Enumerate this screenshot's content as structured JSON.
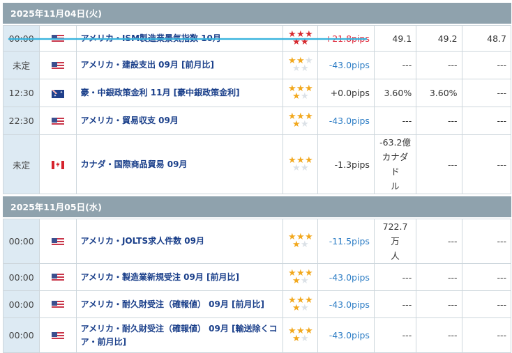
{
  "days": [
    {
      "date": "2025年11月04日(火)",
      "events": [
        {
          "time": "00:00",
          "country": "us",
          "name": "アメリカ・ISM製造業景気指数 10月",
          "stars": [
            "red",
            "red",
            "red",
            "red",
            "red"
          ],
          "pips": "+21.8pips",
          "pips_style": "pos-red",
          "result": "49.1",
          "forecast": "49.2",
          "previous": "48.7",
          "struck": true
        },
        {
          "time": "未定",
          "country": "us",
          "name": "アメリカ・建設支出 09月 [前月比]",
          "stars": [
            "gold",
            "gold",
            "gray",
            "gray",
            "gray"
          ],
          "pips": "-43.0pips",
          "pips_style": "neg",
          "result": "---",
          "forecast": "---",
          "previous": "---"
        },
        {
          "time": "12:30",
          "country": "au",
          "name": "豪・中銀政策金利 11月 [豪中銀政策金利]",
          "stars": [
            "gold",
            "gold",
            "gold",
            "gold",
            "gray"
          ],
          "pips": "+0.0pips",
          "pips_style": "",
          "result": "3.60%",
          "forecast": "3.60%",
          "previous": "---"
        },
        {
          "time": "22:30",
          "country": "us",
          "name": "アメリカ・貿易収支 09月",
          "stars": [
            "gold",
            "gold",
            "gold",
            "gold",
            "gray"
          ],
          "pips": "-43.0pips",
          "pips_style": "neg",
          "result": "---",
          "forecast": "---",
          "previous": "---"
        },
        {
          "time": "未定",
          "country": "ca",
          "name": "カナダ・国際商品貿易 09月",
          "stars": [
            "gold",
            "gold",
            "gold",
            "gray",
            "gray"
          ],
          "pips": "-1.3pips",
          "pips_style": "",
          "result": "-63.2億カナダドル",
          "result_lines": [
            "-63.2億",
            "カナダド",
            "ル"
          ],
          "forecast": "---",
          "previous": "---"
        }
      ]
    },
    {
      "date": "2025年11月05日(水)",
      "events": [
        {
          "time": "00:00",
          "country": "us",
          "name": "アメリカ・JOLTS求人件数 09月",
          "stars": [
            "gold",
            "gold",
            "gold",
            "gold",
            "gray"
          ],
          "pips": "-11.5pips",
          "pips_style": "neg",
          "result": "722.7万人",
          "result_lines": [
            "722.7万",
            "人"
          ],
          "forecast": "---",
          "previous": "---"
        },
        {
          "time": "00:00",
          "country": "us",
          "name": "アメリカ・製造業新規受注 09月 [前月比]",
          "stars": [
            "gold",
            "gold",
            "gold",
            "gold",
            "gray"
          ],
          "pips": "-43.0pips",
          "pips_style": "neg",
          "result": "---",
          "forecast": "---",
          "previous": "---"
        },
        {
          "time": "00:00",
          "country": "us",
          "name": "アメリカ・耐久財受注（確報値） 09月 [前月比]",
          "stars": [
            "gold",
            "gold",
            "gold",
            "gold",
            "gray"
          ],
          "pips": "-43.0pips",
          "pips_style": "neg",
          "result": "---",
          "forecast": "---",
          "previous": "---"
        },
        {
          "time": "00:00",
          "country": "us",
          "name": "アメリカ・耐久財受注（確報値） 09月 [輸送除くコア・前月比]",
          "stars": [
            "gold",
            "gold",
            "gold",
            "gold",
            "gray"
          ],
          "pips": "-43.0pips",
          "pips_style": "neg",
          "result": "---",
          "forecast": "---",
          "previous": "---"
        }
      ]
    }
  ],
  "colors": {
    "header": "#8fa2ad",
    "time_cell": "#ddeaf3",
    "link": "#1a3f8a",
    "neg_pips": "#2d7dc5",
    "star_gold": "#f2a81d",
    "star_red": "#d72a2f",
    "strike_line": "#37b3dd"
  }
}
